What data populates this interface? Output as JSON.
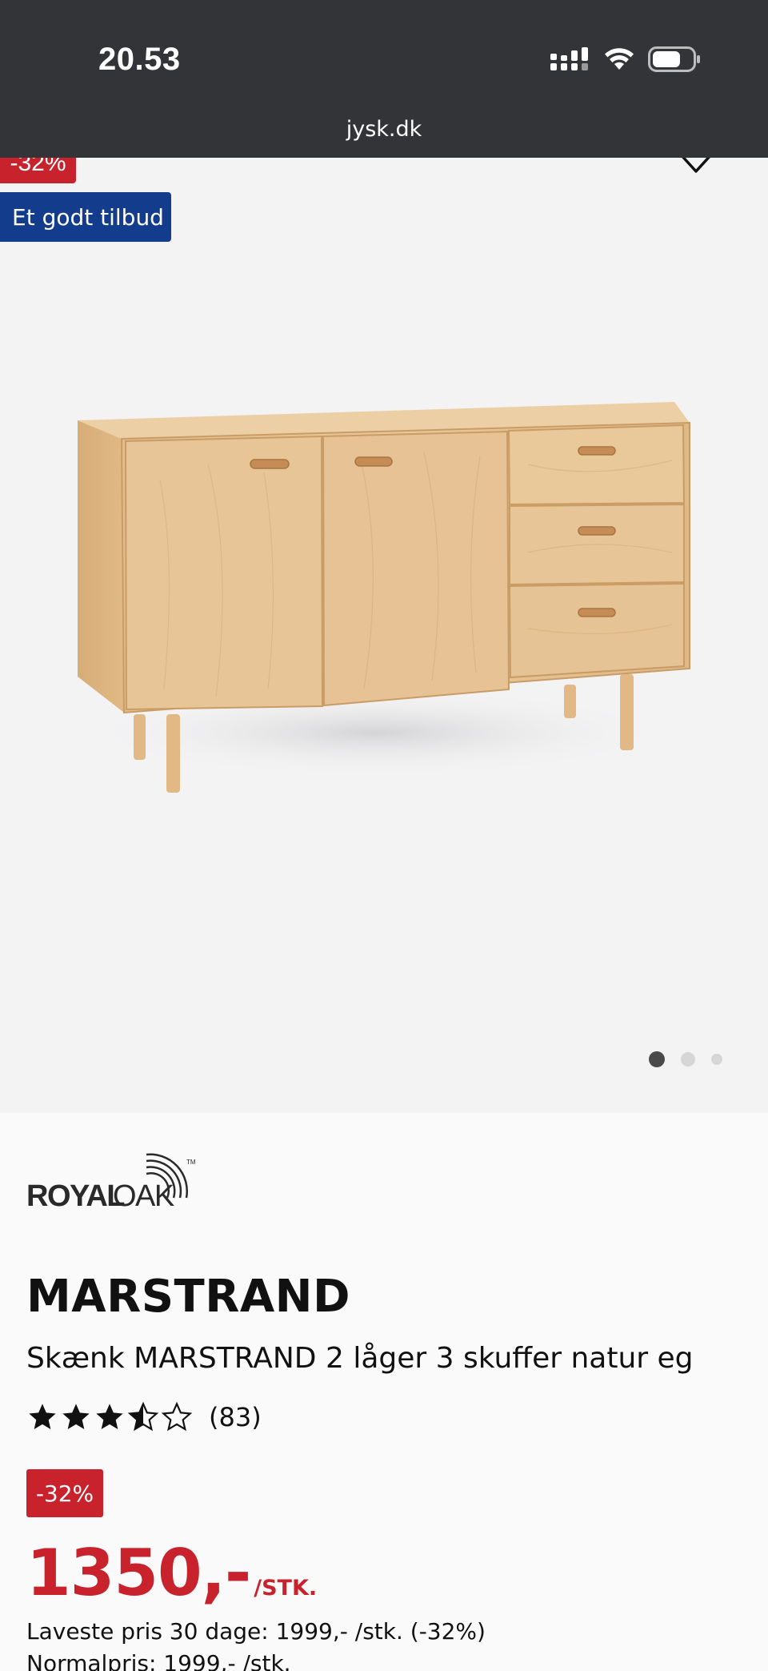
{
  "status_bar": {
    "time": "20.53",
    "url": "jysk.dk"
  },
  "gallery": {
    "discount_badge": "-32%",
    "offer_badge": "Et godt tilbud",
    "slide_count": 3,
    "active_slide": 1
  },
  "product": {
    "brand": "ROYALOAK",
    "brand_tm": "TM",
    "name": "MARSTRAND",
    "description": "Skænk MARSTRAND 2 låger 3 skuffer natur eg",
    "rating": 3.5,
    "rating_max": 5,
    "review_count": "(83)",
    "discount": "-32%",
    "price": "1350,-",
    "price_unit": "/STK.",
    "lowest_price": "Laveste pris 30 dage: 1999,- /stk. (-32%)",
    "normal_price": "Normalpris: 1999,- /stk."
  },
  "colors": {
    "status_bg": "#323437",
    "gallery_bg": "#f3f3f4",
    "sale_red": "#c8222d",
    "offer_blue": "#143c8c"
  }
}
